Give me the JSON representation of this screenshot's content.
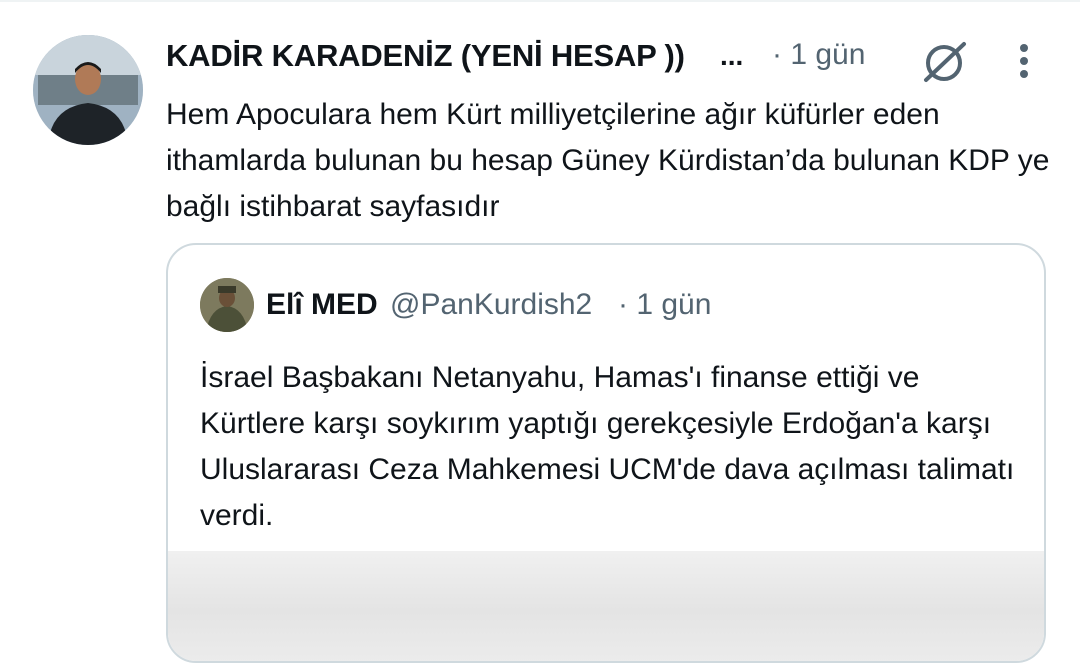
{
  "tweet": {
    "author_name": "KADİR KARADENİZ (YENİ HESAP ))",
    "name_ellipsis": "...",
    "time": "· 1 gün",
    "grok_icon": "grok-slash-circle-icon",
    "more_icon": "vertical-dots-icon",
    "text": "Hem Apoculara hem Kürt milliyetçilerine ağır küfürler eden ithamlarda bulunan bu hesap Güney Kürdistan’da bulunan KDP ye bağlı istihbarat sayfasıdır"
  },
  "quote": {
    "author_name": "Elî MED",
    "handle": "@PanKurdish2",
    "time": "· 1 gün",
    "text": "İsrael Başbakanı Netanyahu, Hamas'ı finanse ettiği ve Kürtlere karşı soykırım yaptığı gerekçesiyle Erdoğan'a karşı Uluslararası Ceza Mahkemesi UCM'de dava açılması talimatı verdi."
  },
  "colors": {
    "text_primary": "#0f1419",
    "text_secondary": "#536471",
    "border": "#cfd9de"
  }
}
